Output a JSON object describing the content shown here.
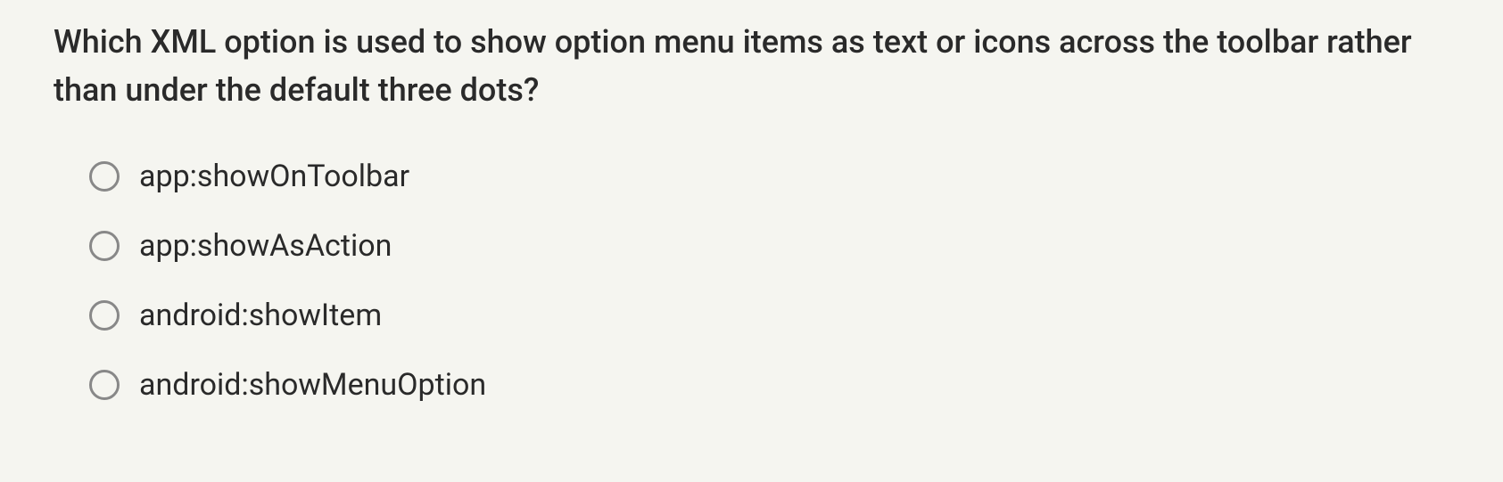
{
  "question": {
    "text": "Which XML option is used to show option menu items as text or icons across the toolbar rather than under the default three dots?"
  },
  "options": [
    {
      "label": "app:showOnToolbar"
    },
    {
      "label": "app:showAsAction"
    },
    {
      "label": "android:showItem"
    },
    {
      "label": "android:showMenuOption"
    }
  ]
}
